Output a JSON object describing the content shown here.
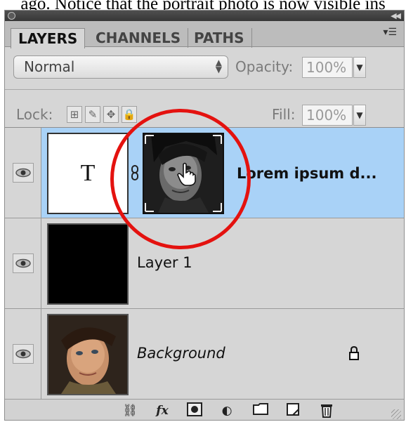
{
  "caption": "ago. Notice that the portrait photo is now visible ins",
  "panel": {
    "tabs": [
      {
        "label": "LAYERS",
        "active": true
      },
      {
        "label": "CHANNELS",
        "active": false
      },
      {
        "label": "PATHS",
        "active": false
      }
    ]
  },
  "blend_mode": "Normal",
  "opacity": {
    "label": "Opacity:",
    "value": "100%"
  },
  "lock": {
    "label": "Lock:"
  },
  "fill": {
    "label": "Fill:",
    "value": "100%"
  },
  "layers": [
    {
      "name": "Lorem ipsum d...",
      "thumb_text": "T",
      "selected": true,
      "style": "bold"
    },
    {
      "name": "Layer 1",
      "selected": false,
      "style": "normal"
    },
    {
      "name": "Background",
      "selected": false,
      "style": "italic"
    }
  ],
  "colors": {
    "selected_row": "#a9d2f7",
    "annotation_circle": "#e4120f",
    "panel_bg": "#d6d6d6"
  },
  "icons": [
    "close-icon",
    "collapse-icon",
    "panel-menu-icon",
    "eye-icon",
    "chain-link-icon",
    "hand-cursor-icon",
    "lock-icon",
    "link-layers-icon",
    "fx-icon",
    "add-mask-icon",
    "adjustment-layer-icon",
    "new-group-icon",
    "new-layer-icon",
    "trash-icon"
  ]
}
